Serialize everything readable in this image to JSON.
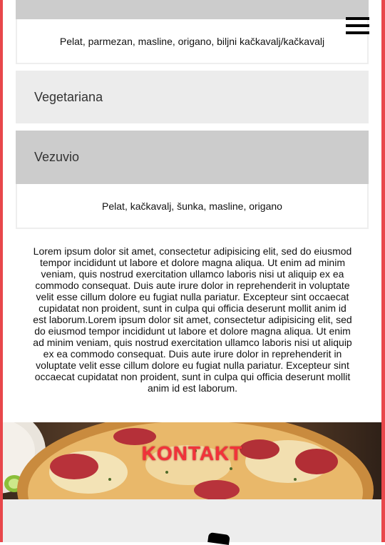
{
  "menu": {
    "icon": "hamburger-menu-icon"
  },
  "pizzas": [
    {
      "name": "",
      "ingredients": "Pelat, parmezan, masline, origano, biljni kačkavalj/kačkavalj"
    },
    {
      "name": "Vegetariana",
      "ingredients": ""
    },
    {
      "name": "Vezuvio",
      "ingredients": "Pelat, kačkavalj, šunka, masline, origano"
    }
  ],
  "about": {
    "text": "Lorem ipsum dolor sit amet, consectetur adipisicing elit, sed do eiusmod tempor incididunt ut labore et dolore magna aliqua. Ut enim ad minim veniam, quis nostrud exercitation ullamco laboris nisi ut aliquip ex ea commodo consequat. Duis aute irure dolor in reprehenderit in voluptate velit esse cillum dolore eu fugiat nulla pariatur. Excepteur sint occaecat cupidatat non proident, sunt in culpa qui officia deserunt mollit anim id est laborum.Lorem ipsum dolor sit amet, consectetur adipisicing elit, sed do eiusmod tempor incididunt ut labore et dolore magna aliqua. Ut enim ad minim veniam, quis nostrud exercitation ullamco laboris nisi ut aliquip ex ea commodo consequat. Duis aute irure dolor in reprehenderit in voluptate velit esse cillum dolore eu fugiat nulla pariatur. Excepteur sint occaecat cupidatat non proident, sunt in culpa qui officia deserunt mollit anim id est laborum."
  },
  "contact": {
    "title": "KONTAKT"
  },
  "colors": {
    "accent": "#e8474b",
    "contact_title": "#f2323a",
    "accordion_open": "#cccccc",
    "accordion_closed": "#ececec"
  }
}
